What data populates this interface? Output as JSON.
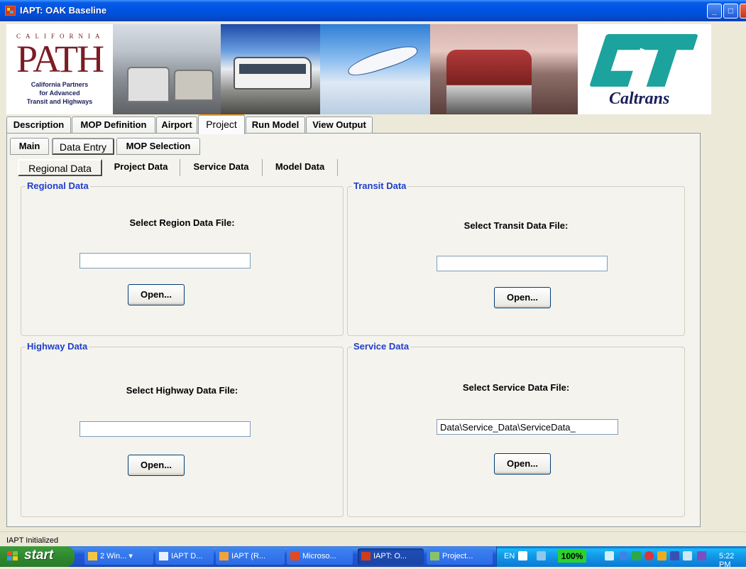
{
  "window": {
    "title": "IAPT: OAK Baseline",
    "controls": {
      "minimize": "_",
      "maximize": "□",
      "close": "X"
    }
  },
  "banner": {
    "path_logo": {
      "california": "CALIFORNIA",
      "mark": "PATH",
      "line1": "California Partners",
      "line2": "for Advanced",
      "line3": "Transit and Highways"
    },
    "caltrans_logo": {
      "wordmark": "Caltrans"
    }
  },
  "main_tabs": [
    {
      "label": "Description"
    },
    {
      "label": "MOP Definition"
    },
    {
      "label": "Airport"
    },
    {
      "label": "Project",
      "active": true
    },
    {
      "label": "Run Model"
    },
    {
      "label": "View Output"
    }
  ],
  "sub_tabs": [
    {
      "label": "Main"
    },
    {
      "label": "Data Entry",
      "active": true
    },
    {
      "label": "MOP Selection"
    }
  ],
  "data_tabs": [
    {
      "label": "Regional Data",
      "active": true
    },
    {
      "label": "Project Data"
    },
    {
      "label": "Service Data"
    },
    {
      "label": "Model Data"
    }
  ],
  "groups": {
    "regional": {
      "title": "Regional Data",
      "prompt": "Select Region Data File:",
      "value": "",
      "button": "Open..."
    },
    "transit": {
      "title": "Transit Data",
      "prompt": "Select Transit Data File:",
      "value": "",
      "button": "Open..."
    },
    "highway": {
      "title": "Highway Data",
      "prompt": "Select Highway Data File:",
      "value": "",
      "button": "Open..."
    },
    "service": {
      "title": "Service Data",
      "prompt": "Select Service Data File:",
      "value": "Data\\Service_Data\\ServiceData_",
      "button": "Open..."
    }
  },
  "status": {
    "text": "IAPT Initialized"
  },
  "taskbar": {
    "start_label": "start",
    "tasks": [
      {
        "label": "2 Win...",
        "icon": "folder-icon",
        "color": "#f5c542"
      },
      {
        "label": "IAPT D...",
        "icon": "document-icon",
        "color": "#e8f0ff"
      },
      {
        "label": "IAPT (R...",
        "icon": "app-icon",
        "color": "#f0a33a"
      },
      {
        "label": "Microso...",
        "icon": "office-icon",
        "color": "#e24a1d"
      },
      {
        "label": "IAPT: O...",
        "icon": "iapt-icon",
        "color": "#d23c1b",
        "active": true
      },
      {
        "label": "Project...",
        "icon": "project-icon",
        "color": "#8ac26b"
      }
    ],
    "tray": {
      "lang": "EN",
      "zoom": "100%",
      "clock": "5:22 PM"
    }
  }
}
